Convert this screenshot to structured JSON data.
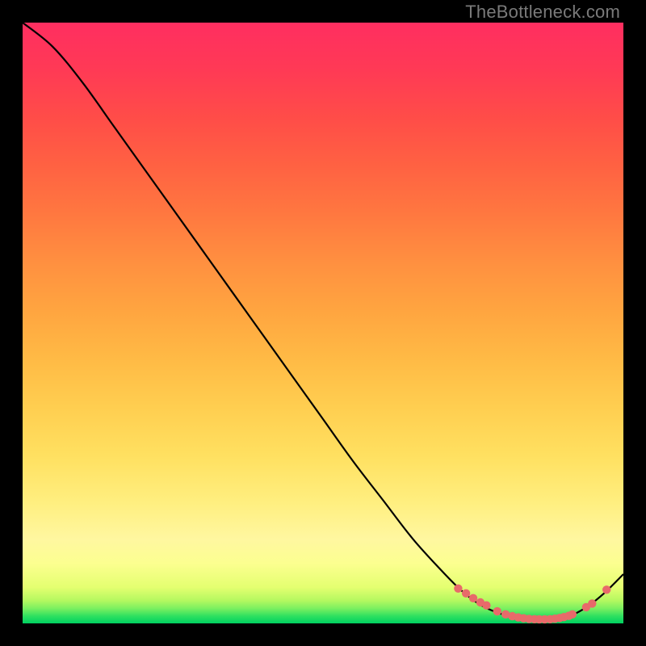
{
  "watermark": "TheBottleneck.com",
  "colors": {
    "dot": "#e86a6a",
    "curve": "#000000"
  },
  "chart_data": {
    "type": "line",
    "title": "",
    "xlabel": "",
    "ylabel": "",
    "xlim": [
      0,
      100
    ],
    "ylim": [
      0,
      100
    ],
    "grid": false,
    "legend": false,
    "series": [
      {
        "name": "bottleneck-curve",
        "x": [
          0,
          5,
          10,
          15,
          20,
          25,
          30,
          35,
          40,
          45,
          50,
          55,
          60,
          65,
          70,
          73,
          76,
          79,
          82,
          85,
          88,
          91,
          94,
          97,
          100
        ],
        "y": [
          100,
          96,
          90,
          83,
          76,
          69,
          62,
          55,
          48,
          41,
          34,
          27,
          20.5,
          14,
          8.5,
          5.5,
          3.2,
          1.8,
          1.0,
          0.7,
          0.7,
          1.2,
          2.8,
          5.2,
          8.2
        ]
      }
    ],
    "points": {
      "name": "highlight-dots",
      "x": [
        72.5,
        73.8,
        75.0,
        76.2,
        77.2,
        79.0,
        80.4,
        81.5,
        82.5,
        83.4,
        84.3,
        85.2,
        86.0,
        86.9,
        87.8,
        88.6,
        89.4,
        90.1,
        90.9,
        91.5,
        93.8,
        94.8,
        97.2
      ],
      "y": [
        5.8,
        5.0,
        4.2,
        3.5,
        3.0,
        2.0,
        1.5,
        1.2,
        1.0,
        0.85,
        0.75,
        0.7,
        0.68,
        0.68,
        0.7,
        0.78,
        0.9,
        1.05,
        1.25,
        1.5,
        2.7,
        3.3,
        5.6
      ]
    }
  }
}
